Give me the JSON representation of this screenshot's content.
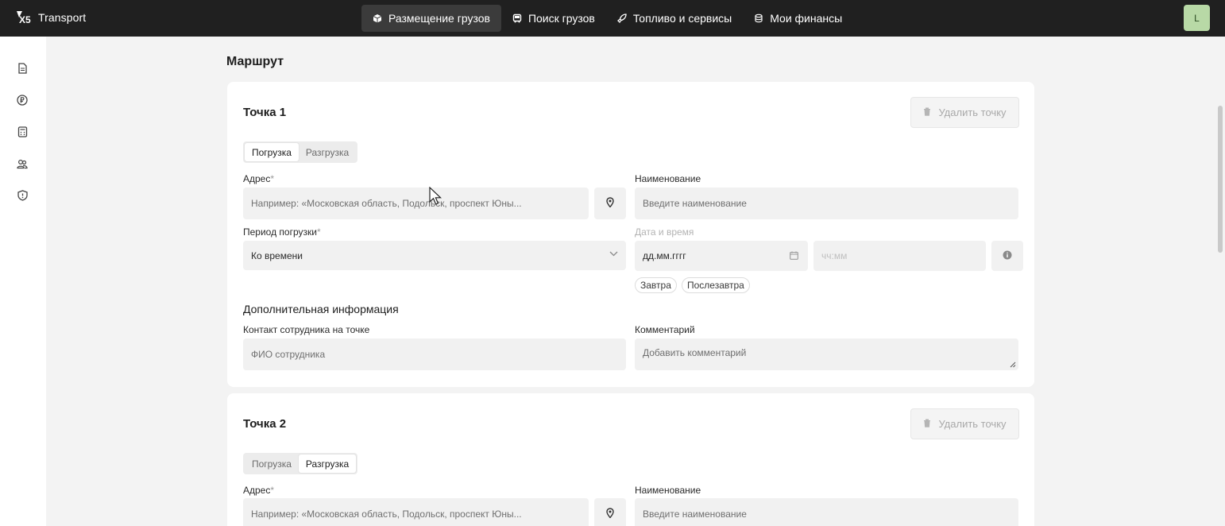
{
  "topbar": {
    "logo_mark": "X5",
    "logo_text": "Transport",
    "nav": [
      {
        "label": "Размещение грузов",
        "icon": "box-icon",
        "active": true
      },
      {
        "label": "Поиск грузов",
        "icon": "truck-icon",
        "active": false
      },
      {
        "label": "Топливо и сервисы",
        "icon": "rocket-icon",
        "active": false
      },
      {
        "label": "Мои финансы",
        "icon": "coins-icon",
        "active": false
      }
    ],
    "avatar_initial": "L"
  },
  "sidebar": {
    "items": [
      {
        "icon": "document-icon"
      },
      {
        "icon": "ruble-icon"
      },
      {
        "icon": "calculator-icon"
      },
      {
        "icon": "users-icon"
      },
      {
        "icon": "shield-icon"
      }
    ]
  },
  "route": {
    "title": "Маршрут",
    "points": [
      {
        "title": "Точка 1",
        "delete_label": "Удалить точку",
        "segments": [
          "Погрузка",
          "Разгрузка"
        ],
        "active_segment": 0,
        "address_label": "Адрес",
        "address_placeholder": "Например: «Московская область, Подольск, проспект Юны...",
        "name_label": "Наименование",
        "name_placeholder": "Введите наименование",
        "period_label": "Период погрузки",
        "period_value": "Ко времени",
        "datetime_label": "Дата и время",
        "date_placeholder": "дд.мм.гггг",
        "time_placeholder": "чч:мм",
        "chips": [
          "Завтра",
          "Послезавтра"
        ],
        "extra_title": "Дополнительная информация",
        "contact_label": "Контакт сотрудника на точке",
        "contact_placeholder": "ФИО сотрудника",
        "comment_label": "Комментарий",
        "comment_placeholder": "Добавить комментарий"
      },
      {
        "title": "Точка 2",
        "delete_label": "Удалить точку",
        "segments": [
          "Погрузка",
          "Разгрузка"
        ],
        "active_segment": 1,
        "address_label": "Адрес",
        "address_placeholder": "Например: «Московская область, Подольск, проспект Юны...",
        "name_label": "Наименование",
        "name_placeholder": "Введите наименование"
      }
    ]
  },
  "required_mark": "*"
}
